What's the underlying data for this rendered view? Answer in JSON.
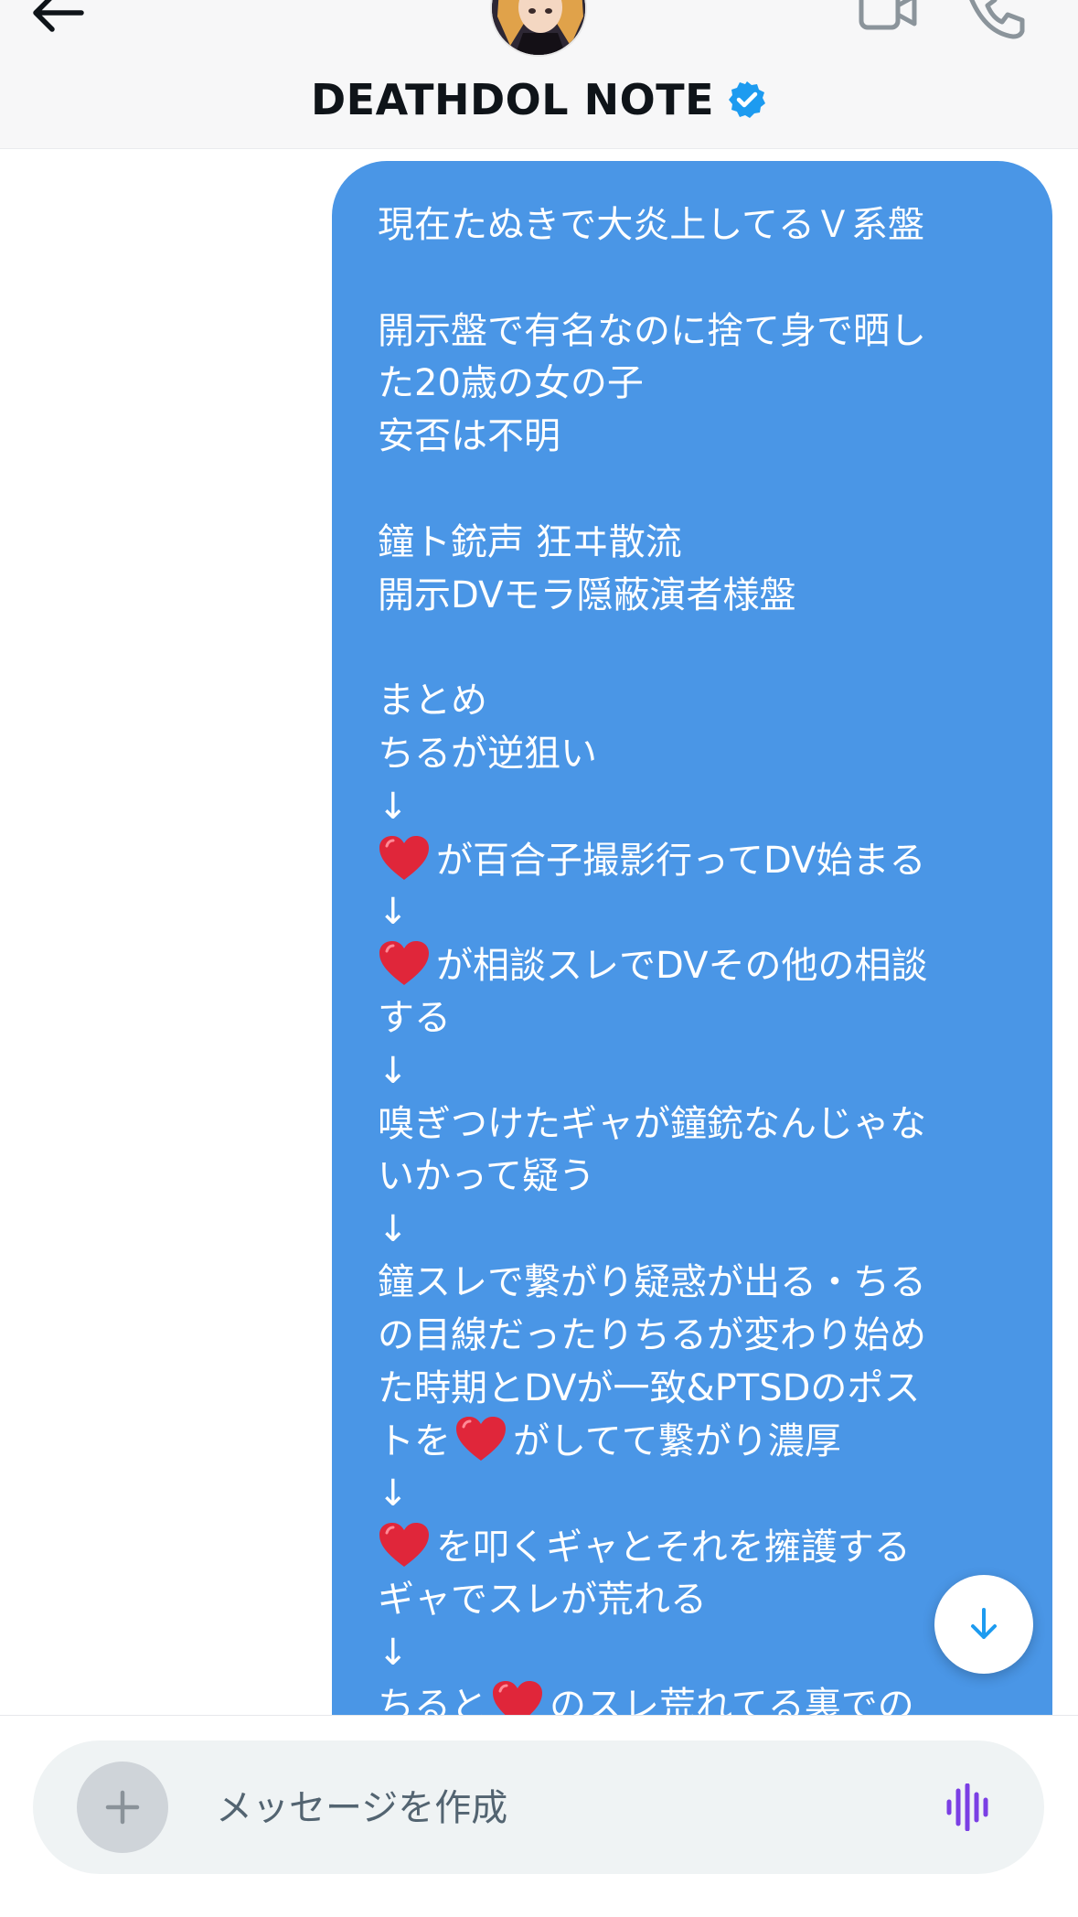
{
  "header": {
    "title": "DEATHDOL NOTE",
    "verified": true,
    "icons": {
      "back": "arrow-left-icon",
      "video": "video-camera-icon",
      "call": "phone-icon",
      "verified": "verified-badge-icon"
    }
  },
  "colors": {
    "bubble": "#4a96e6",
    "verified": "#1d9bf0",
    "voice_icon": "#7b3fe4",
    "heart": "#e0263a"
  },
  "message": {
    "lines": [
      {
        "text": "現在たぬきで大炎上してるＶ系盤"
      },
      {
        "text": ""
      },
      {
        "text": "開示盤で有名なのに捨て身で晒し"
      },
      {
        "text": "た20歳の女の子"
      },
      {
        "text": "安否は不明"
      },
      {
        "text": ""
      },
      {
        "text": "鐘ト銃声 狂ヰ散流"
      },
      {
        "text": "開示DVモラ隠蔽演者様盤"
      },
      {
        "text": ""
      },
      {
        "text": "まとめ"
      },
      {
        "text": "ちるが逆狙い"
      },
      {
        "text": "↓"
      },
      {
        "text": "が百合子撮影行ってDV始まる",
        "heart": true
      },
      {
        "text": "↓"
      },
      {
        "text": "が相談スレでDVその他の相談",
        "heart": true
      },
      {
        "text": "する"
      },
      {
        "text": "↓"
      },
      {
        "text": "嗅ぎつけたギャが鐘銃なんじゃな"
      },
      {
        "text": "いかって疑う"
      },
      {
        "text": "↓"
      },
      {
        "text": "鐘スレで繋がり疑惑が出る・ちる"
      },
      {
        "text": "の目線だったりちるが変わり始め"
      },
      {
        "text": "た時期とDVが一致&PTSDのポス"
      },
      {
        "text": "トを",
        "heart_after": true,
        "after": "がしてて繋がり濃厚"
      },
      {
        "text": "↓"
      },
      {
        "text": "を叩くギャとそれを擁護する",
        "heart": true
      },
      {
        "text": "ギャでスレが荒れる"
      },
      {
        "text": "↓"
      },
      {
        "text": "ちると",
        "heart_after": true,
        "after": "のスレ荒れてる裏での"
      }
    ]
  },
  "scroll_button": {
    "icon": "arrow-down-icon"
  },
  "composer": {
    "placeholder": "メッセージを作成",
    "icons": {
      "attach": "plus-icon",
      "voice": "voice-waveform-icon"
    }
  }
}
